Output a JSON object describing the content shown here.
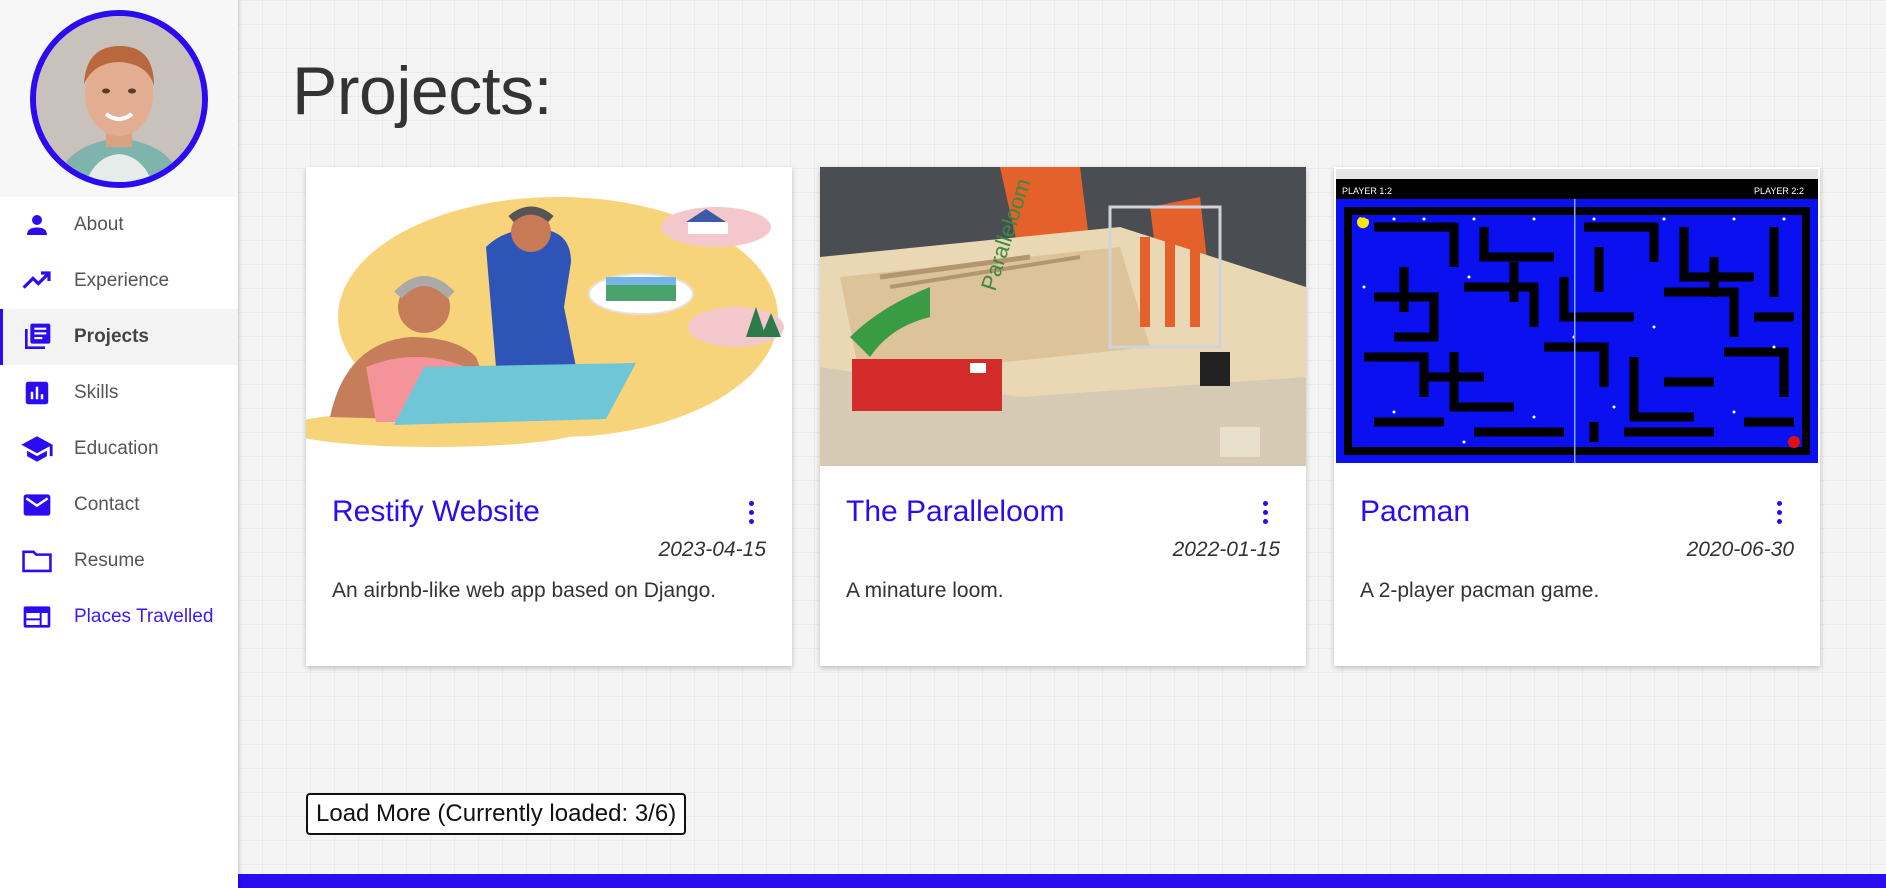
{
  "sidebar": {
    "items": [
      {
        "label": "About",
        "icon": "person-icon"
      },
      {
        "label": "Experience",
        "icon": "trending-up-icon"
      },
      {
        "label": "Projects",
        "icon": "library-books-icon"
      },
      {
        "label": "Skills",
        "icon": "bar-chart-icon"
      },
      {
        "label": "Education",
        "icon": "school-icon"
      },
      {
        "label": "Contact",
        "icon": "mail-icon"
      },
      {
        "label": "Resume",
        "icon": "folder-icon"
      },
      {
        "label": "Places Travelled",
        "icon": "web-icon"
      }
    ],
    "active": "Projects"
  },
  "main": {
    "title": "Projects:",
    "projects": [
      {
        "title": "Restify Website",
        "date": "2023-04-15",
        "description": "An airbnb-like web app based on Django."
      },
      {
        "title": "The Paralleloom",
        "date": "2022-01-15",
        "description": "A minature loom."
      },
      {
        "title": "Pacman",
        "date": "2020-06-30",
        "description": "A 2-player pacman game."
      }
    ],
    "load_more": "Load More (Currently loaded: 3/6)"
  },
  "images": {
    "pacman": {
      "player1": "PLAYER 1:",
      "player1_score": "2",
      "player2": "PLAYER 2:",
      "player2_score": "2"
    },
    "loom": {
      "brand": "Paralleloom"
    }
  },
  "colors": {
    "accent": "#2b0cf0",
    "text": "#333333"
  }
}
